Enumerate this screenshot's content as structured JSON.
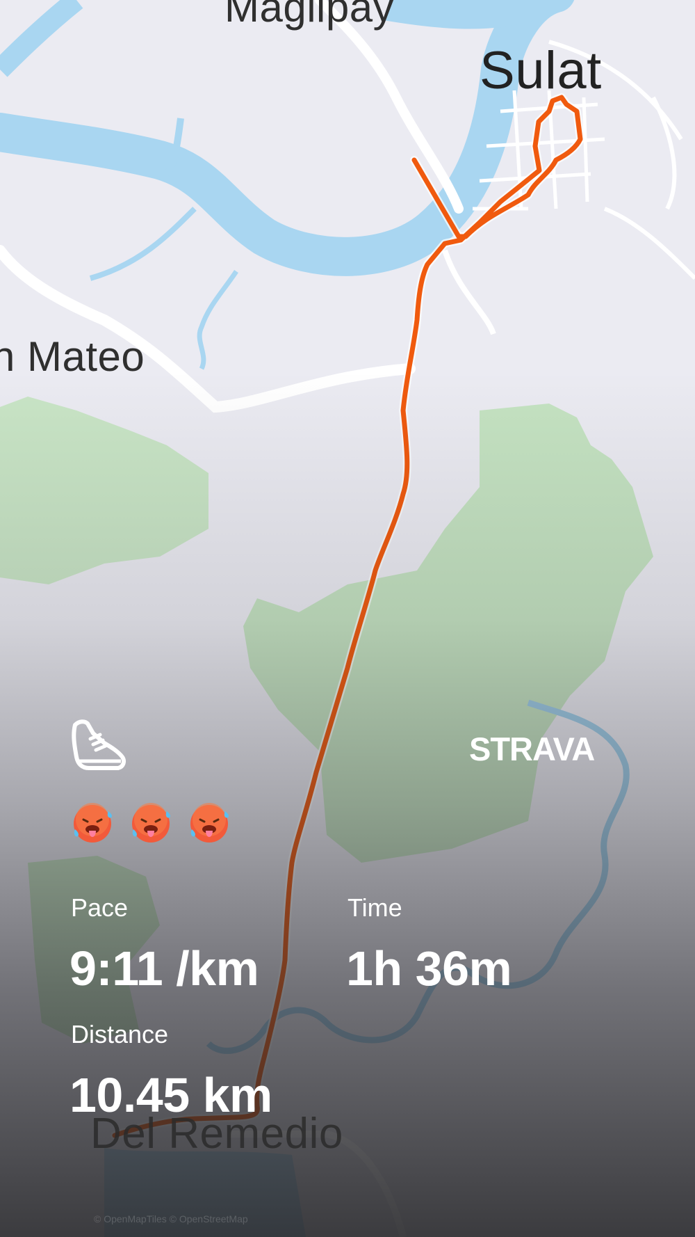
{
  "map": {
    "places": {
      "maglipay": "Maglipay",
      "sulat": "Sulat",
      "mateo": "n Mateo",
      "remedio": "Del Remedio"
    },
    "attribution": "© OpenMapTiles © OpenStreetMap",
    "route_color": "#f05a0e",
    "water_color": "#a9d6f1",
    "park_color": "#c7e6c5",
    "road_color": "#ffffff"
  },
  "activity": {
    "type_icon": "running-shoe-icon",
    "brand": "STRAVA",
    "emojis": [
      "hot-face-icon",
      "hot-face-icon",
      "hot-face-icon"
    ],
    "stats": {
      "pace_label": "Pace",
      "pace_value": "9:11 /km",
      "time_label": "Time",
      "time_value": "1h 36m",
      "distance_label": "Distance",
      "distance_value": "10.45 km"
    }
  }
}
